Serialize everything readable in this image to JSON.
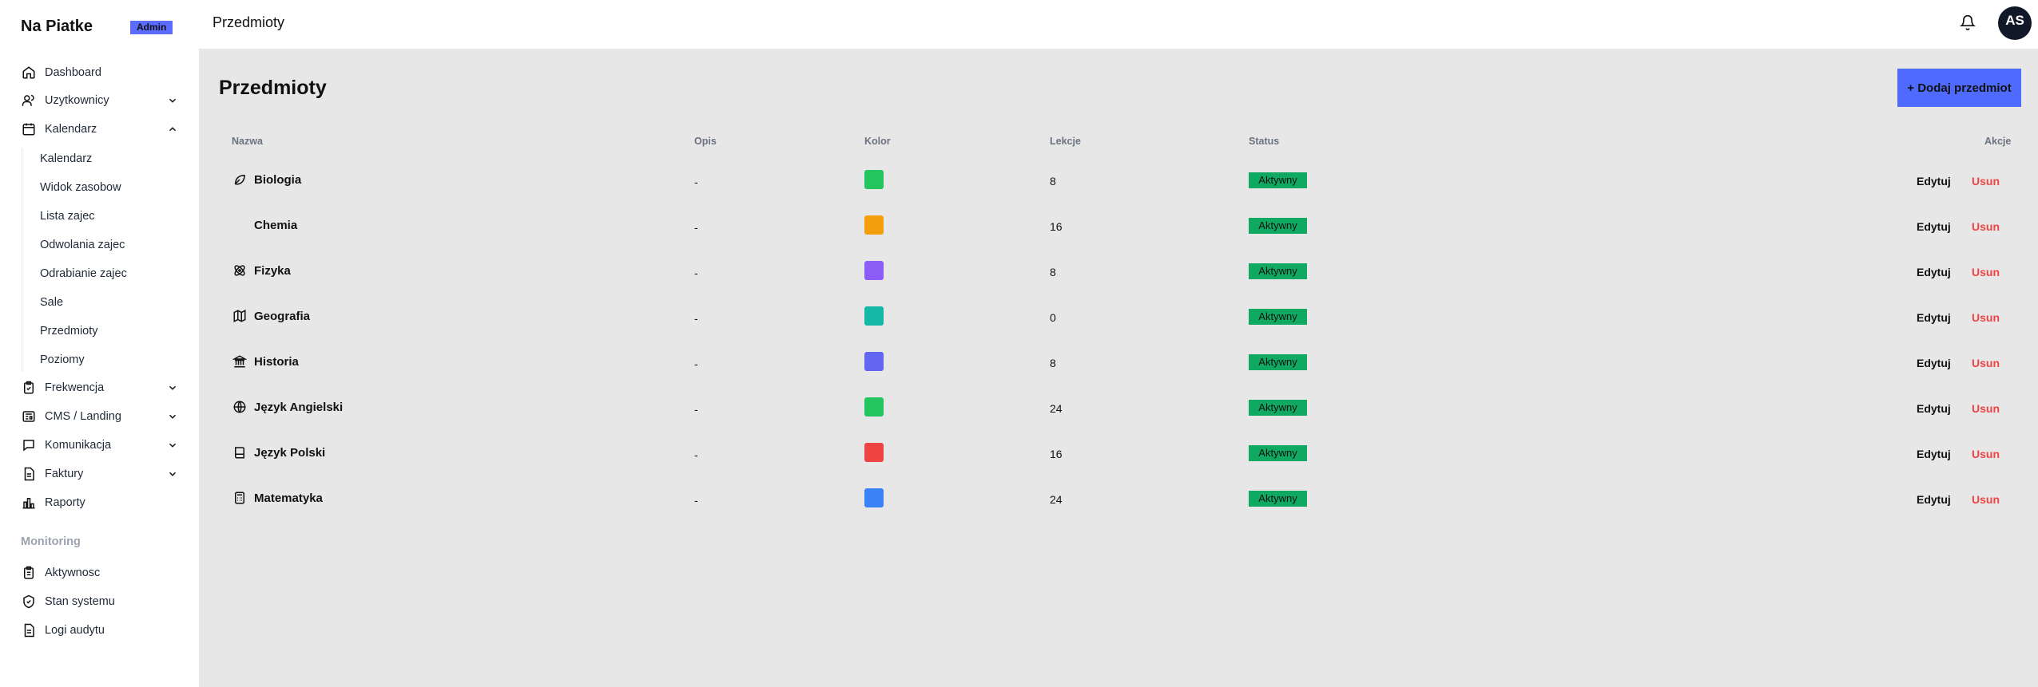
{
  "brand": "Na Piatke",
  "admin_badge": "Admin",
  "header_title": "Przedmioty",
  "avatar_initials": "AS",
  "nav": {
    "dashboard": "Dashboard",
    "users": "Uzytkownicy",
    "calendar": "Kalendarz",
    "attendance": "Frekwencja",
    "cms": "CMS / Landing",
    "communication": "Komunikacja",
    "invoices": "Faktury",
    "reports": "Raporty"
  },
  "calendar_sub": [
    "Kalendarz",
    "Widok zasobow",
    "Lista zajec",
    "Odwolania zajec",
    "Odrabianie zajec",
    "Sale",
    "Przedmioty",
    "Poziomy"
  ],
  "monitoring": {
    "label": "Monitoring",
    "activity": "Aktywnosc",
    "system": "Stan systemu",
    "audit": "Logi audytu"
  },
  "page_title": "Przedmioty",
  "add_button": "+ Dodaj przedmiot",
  "table": {
    "headers": {
      "name": "Nazwa",
      "desc": "Opis",
      "color": "Kolor",
      "lessons": "Lekcje",
      "status": "Status",
      "actions": "Akcje"
    },
    "rows": [
      {
        "name": "Biologia",
        "icon": "leaf-icon",
        "desc": "-",
        "color": "#22c55e",
        "lessons": "8",
        "status": "Aktywny"
      },
      {
        "name": "Chemia",
        "icon": "",
        "desc": "-",
        "color": "#f59e0b",
        "lessons": "16",
        "status": "Aktywny"
      },
      {
        "name": "Fizyka",
        "icon": "atom-icon",
        "desc": "-",
        "color": "#8b5cf6",
        "lessons": "8",
        "status": "Aktywny"
      },
      {
        "name": "Geografia",
        "icon": "map-icon",
        "desc": "-",
        "color": "#14b8a6",
        "lessons": "0",
        "status": "Aktywny"
      },
      {
        "name": "Historia",
        "icon": "landmark-icon",
        "desc": "-",
        "color": "#6366f1",
        "lessons": "8",
        "status": "Aktywny"
      },
      {
        "name": "Język Angielski",
        "icon": "globe-icon",
        "desc": "-",
        "color": "#22c55e",
        "lessons": "24",
        "status": "Aktywny"
      },
      {
        "name": "Język Polski",
        "icon": "book-icon",
        "desc": "-",
        "color": "#ef4444",
        "lessons": "16",
        "status": "Aktywny"
      },
      {
        "name": "Matematyka",
        "icon": "calculator-icon",
        "desc": "-",
        "color": "#3b82f6",
        "lessons": "24",
        "status": "Aktywny"
      }
    ],
    "edit_label": "Edytuj",
    "delete_label": "Usun"
  }
}
